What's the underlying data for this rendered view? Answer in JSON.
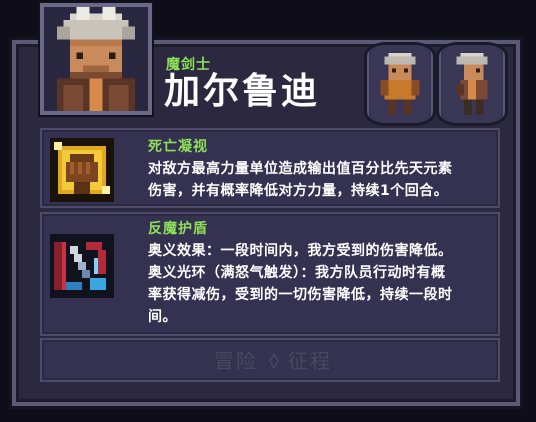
{
  "hero": {
    "class": "魔剑士",
    "name": "加尔鲁迪"
  },
  "portrait": {
    "icon": "white-haired-warrior-portrait"
  },
  "skins": [
    {
      "icon": "hero-skin-armor-icon"
    },
    {
      "icon": "hero-skin-casual-icon"
    }
  ],
  "skills": [
    {
      "name": "死亡凝视",
      "icon": "golden-fist-icon",
      "description_lines": [
        "对敌方最高力量单位造成输出值百分比先天元素",
        "伤害，并有概率降低对方力量，持续1个回合。"
      ]
    },
    {
      "name": "反魔护盾",
      "icon": "anti-magic-shield-icon",
      "description_lines": [
        "奥义效果：一段时间内，我方受到的伤害降低。",
        "奥义光环（满怒气触发）：我方队员行动时有概",
        "率获得减伤，受到的一切伤害降低，持续一段时",
        "间。"
      ]
    }
  ],
  "watermark": "冒险征程",
  "colors": {
    "background": "#0f0e18",
    "card": "#2b2840",
    "panel": "#353150",
    "accent_green": "#8ee05a",
    "text": "#ffffff"
  }
}
